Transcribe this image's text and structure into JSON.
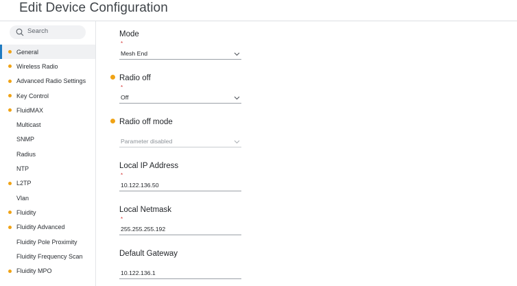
{
  "page": {
    "title": "Edit Device Configuration"
  },
  "search": {
    "placeholder": "Search"
  },
  "sidebar": {
    "items": [
      {
        "label": "General",
        "modified": true,
        "active": true
      },
      {
        "label": "Wireless Radio",
        "modified": true,
        "active": false
      },
      {
        "label": "Advanced Radio Settings",
        "modified": true,
        "active": false
      },
      {
        "label": "Key Control",
        "modified": true,
        "active": false
      },
      {
        "label": "FluidMAX",
        "modified": true,
        "active": false
      },
      {
        "label": "Multicast",
        "modified": false,
        "active": false
      },
      {
        "label": "SNMP",
        "modified": false,
        "active": false
      },
      {
        "label": "Radius",
        "modified": false,
        "active": false
      },
      {
        "label": "NTP",
        "modified": false,
        "active": false
      },
      {
        "label": "L2TP",
        "modified": true,
        "active": false
      },
      {
        "label": "Vlan",
        "modified": false,
        "active": false
      },
      {
        "label": "Fluidity",
        "modified": true,
        "active": false
      },
      {
        "label": "Fluidity Advanced",
        "modified": true,
        "active": false
      },
      {
        "label": "Fluidity Pole Proximity",
        "modified": false,
        "active": false
      },
      {
        "label": "Fluidity Frequency Scan",
        "modified": false,
        "active": false
      },
      {
        "label": "Fluidity MPO",
        "modified": true,
        "active": false
      }
    ]
  },
  "form": {
    "mode": {
      "label": "Mode",
      "required_mark": "*",
      "value": "Mesh End"
    },
    "radio_off": {
      "label": "Radio off",
      "required_mark": "*",
      "value": "Off"
    },
    "radio_off_mode": {
      "label": "Radio off mode",
      "value": "Parameter disabled"
    },
    "local_ip": {
      "label": "Local IP Address",
      "required_mark": "*",
      "value": "10.122.136.50"
    },
    "local_netmask": {
      "label": "Local Netmask",
      "required_mark": "*",
      "value": "255.255.255.192"
    },
    "default_gateway": {
      "label": "Default Gateway",
      "value": "10.122.136.1"
    }
  },
  "colors": {
    "accent": "#1f7bc1",
    "modified_dot": "#f0a315",
    "required": "#d63a3a"
  }
}
